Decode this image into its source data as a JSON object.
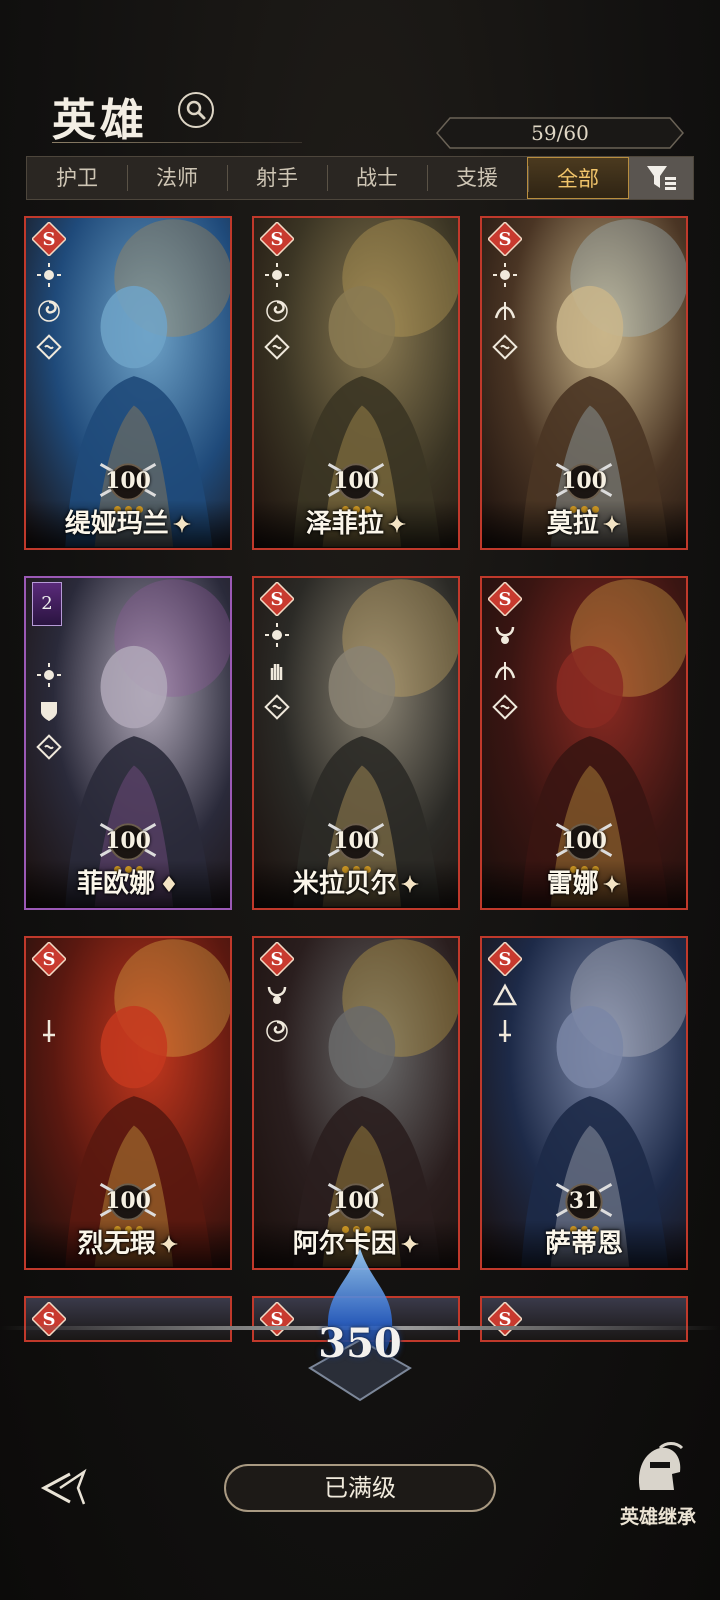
{
  "header": {
    "title": "英雄",
    "count": "59/60"
  },
  "tabs": [
    {
      "label": "护卫",
      "active": false
    },
    {
      "label": "法师",
      "active": false
    },
    {
      "label": "射手",
      "active": false
    },
    {
      "label": "战士",
      "active": false
    },
    {
      "label": "支援",
      "active": false
    },
    {
      "label": "全部",
      "active": true
    }
  ],
  "heroes": [
    {
      "name": "缇娅玛兰",
      "level": "100",
      "art": [
        "#1f4a7a",
        "#6fa3c8",
        "#b88c4a"
      ]
    },
    {
      "name": "泽菲拉",
      "level": "100",
      "art": [
        "#3b3524",
        "#8a7a52",
        "#c9a85c"
      ]
    },
    {
      "name": "莫拉",
      "level": "100",
      "art": [
        "#4a3524",
        "#c9b58a",
        "#a7c3cf"
      ]
    },
    {
      "name": "菲欧娜",
      "level": "100",
      "rank": "2",
      "art": [
        "#2a2a3a",
        "#b0a8b8",
        "#8e5a9c"
      ]
    },
    {
      "name": "米拉贝尔",
      "level": "100",
      "art": [
        "#2b2a26",
        "#8a8373",
        "#d6b56a"
      ]
    },
    {
      "name": "雷娜",
      "level": "100",
      "art": [
        "#3a1512",
        "#8a2a22",
        "#e0b24a"
      ]
    },
    {
      "name": "烈无瑕",
      "level": "100",
      "art": [
        "#5a1810",
        "#c4381e",
        "#e1b94a"
      ]
    },
    {
      "name": "阿尔卡因",
      "level": "100",
      "art": [
        "#2a1e1e",
        "#6a6a6a",
        "#d2b04a"
      ]
    },
    {
      "name": "萨蒂恩",
      "level": "31",
      "art": [
        "#1d2a48",
        "#7a86a6",
        "#c9c9cf"
      ]
    }
  ],
  "bottom": {
    "flame_value": "350",
    "max_button": "已满级",
    "inherit_label": "英雄继承"
  },
  "colors": {
    "card_border": "#c0392b",
    "special_border": "#9b59b6",
    "active_tab": "#f1c46a"
  }
}
